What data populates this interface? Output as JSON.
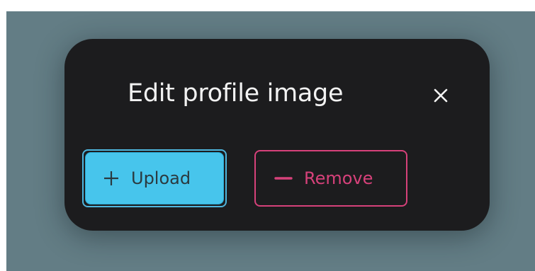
{
  "dialog": {
    "title": "Edit profile image",
    "close_icon": "close-icon"
  },
  "actions": {
    "upload_label": "Upload",
    "upload_icon": "plus-icon",
    "remove_label": "Remove",
    "remove_icon": "minus-icon"
  },
  "colors": {
    "backdrop": "#637d85",
    "dialog_bg": "#1c1c1e",
    "title_text": "#f2f2f2",
    "upload_bg": "#47c5ec",
    "upload_text": "#2b3a40",
    "remove_accent": "#d6417a"
  }
}
